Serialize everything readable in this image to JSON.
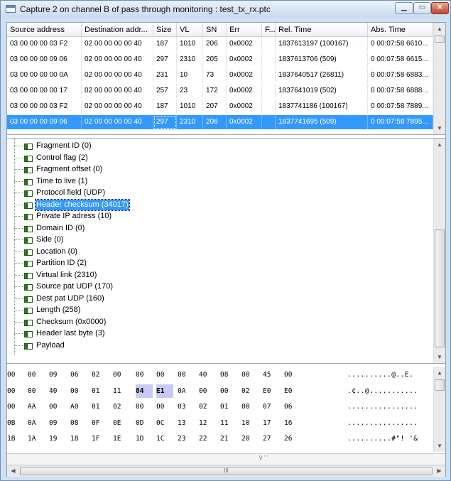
{
  "window": {
    "title": "Capture 2 on channel B of pass through monitoring : test_tx_rx.ptc",
    "minimize": "▁",
    "maximize": "▭",
    "close": "✕"
  },
  "table": {
    "columns": [
      "Source address",
      "Destination addr...",
      "Size",
      "VL",
      "SN",
      "Err",
      "F...",
      "Rel. Time",
      "Abs. Time"
    ],
    "rows": [
      [
        "03 00 00 00 03 F2",
        "02 00 00 00 00 40",
        "187",
        "1010",
        "206",
        "0x0002",
        "",
        "1837613197 (100167)",
        "0 00:07:58 6610..."
      ],
      [
        "03 00 00 00 09 06",
        "02 00 00 00 00 40",
        "297",
        "2310",
        "205",
        "0x0002",
        "",
        "1837613706 (509)",
        "0 00:07:58 6615..."
      ],
      [
        "03 00 00 00 00 0A",
        "02 00 00 00 00 40",
        "231",
        "10",
        "73",
        "0x0002",
        "",
        "1837640517 (26811)",
        "0 00:07:58 6883..."
      ],
      [
        "03 00 00 00 00 17",
        "02 00 00 00 00 40",
        "257",
        "23",
        "172",
        "0x0002",
        "",
        "1837641019 (502)",
        "0 00:07:58 6888..."
      ],
      [
        "03 00 00 00 03 F2",
        "02 00 00 00 00 40",
        "187",
        "1010",
        "207",
        "0x0002",
        "",
        "1837741186 (100167)",
        "0 00:07:58 7889..."
      ],
      [
        "03 00 00 00 09 06",
        "02 00 00 00 00 40",
        "297",
        "2310",
        "206",
        "0x0002",
        "",
        "1837741695 (509)",
        "0 00:07:58 7895..."
      ]
    ],
    "selected_row": 5
  },
  "tree": {
    "items": [
      "Fragment ID (0)",
      "Control flag (2)",
      "Fragment offset (0)",
      "Time to live (1)",
      "Protocol field (UDP)",
      "Header checksum (34017)",
      "Private IP adress (10)",
      "Domain ID (0)",
      "Side (0)",
      "Location (0)",
      "Partition ID (2)",
      "Virtual link (2310)",
      "Source pat UDP (170)",
      "Dest pat UDP (160)",
      "Length (258)",
      "Checksum (0x0000)",
      "Header last byte (3)",
      "Payload"
    ],
    "selected_item": 5
  },
  "hex": {
    "rows": [
      {
        "bytes": [
          "00",
          "00",
          "09",
          "06",
          "02",
          "00",
          "00",
          "00",
          "00",
          "40",
          "08",
          "00",
          "45",
          "00"
        ],
        "ascii": "..........@..E."
      },
      {
        "bytes": [
          "00",
          "00",
          "40",
          "00",
          "01",
          "11",
          "84",
          "E1",
          "0A",
          "00",
          "00",
          "02",
          "E0",
          "E0"
        ],
        "ascii": ".¢..@..........."
      },
      {
        "bytes": [
          "00",
          "AA",
          "00",
          "A0",
          "01",
          "02",
          "00",
          "00",
          "03",
          "02",
          "01",
          "00",
          "07",
          "06"
        ],
        "ascii": "................"
      },
      {
        "bytes": [
          "0B",
          "0A",
          "09",
          "08",
          "0F",
          "0E",
          "0D",
          "0C",
          "13",
          "12",
          "11",
          "10",
          "17",
          "16"
        ],
        "ascii": "................"
      },
      {
        "bytes": [
          "1B",
          "1A",
          "19",
          "18",
          "1F",
          "1E",
          "1D",
          "1C",
          "23",
          "22",
          "21",
          "20",
          "27",
          "26"
        ],
        "ascii": "..........#\"! '&"
      }
    ],
    "highlight_row": 1,
    "highlight_bytes": [
      6,
      7
    ]
  },
  "hscroll": {
    "grip": "III"
  },
  "strip": {
    "grip": "\\/ ' '"
  }
}
